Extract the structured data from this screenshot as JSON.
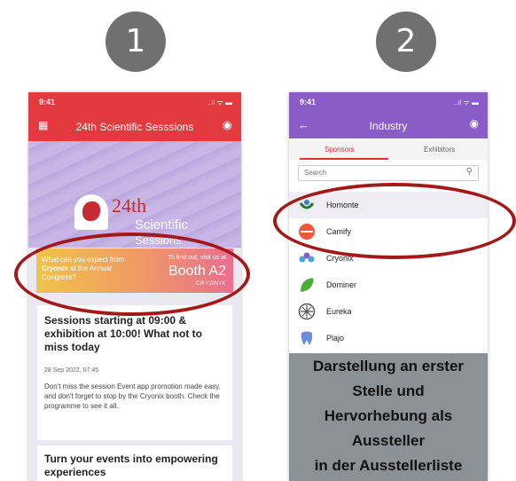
{
  "steps": [
    "1",
    "2"
  ],
  "phone1": {
    "status_time": "9:41",
    "status_icons": "..ıl ᯤ ▬",
    "title": "24th Scientific Sesssions",
    "grid_icon": "qr-grid-icon",
    "user_icon": "user-circle-icon",
    "banner": {
      "line1": "24th",
      "line2": "Scientific",
      "line3": "Sessions"
    },
    "ad": {
      "left_text_pre": "What can you expect from ",
      "left_text_brand": "Cryonix",
      "left_text_post": " at the Annual Congress?",
      "right_small": "To find out, visit us at",
      "right_big": "Booth A2",
      "brand": "CRYONIX"
    },
    "news": {
      "headline": "Sessions starting at 09:00 & exhibition at 10:00! What not to miss today",
      "date": "28 Sep 2022, 07:45",
      "body": "Don't miss the session Event app promotion made easy, and don't forget to stop by the Cryonix booth. Check the programme to see it all."
    },
    "news2": {
      "headline": "Turn your events into empowering experiences"
    }
  },
  "phone2": {
    "status_time": "9:41",
    "status_icons": "..ıl ᯤ ▬",
    "title": "Industry",
    "tabs": {
      "sponsors": "Sponsors",
      "exhibitors": "Exhibitors"
    },
    "search": {
      "placeholder": "Search",
      "value": ""
    },
    "sponsors": [
      {
        "name": "Homonte",
        "color": "#2f6f3f"
      },
      {
        "name": "Camify",
        "color": "#f0563a"
      },
      {
        "name": "Cryonix",
        "color": "#4fa3d8"
      },
      {
        "name": "Dominer",
        "color": "#4caf3c"
      },
      {
        "name": "Eureka",
        "color": "#555555"
      },
      {
        "name": "Plajo",
        "color": "#6a8fd8"
      }
    ],
    "caption": [
      "Darstellung an erster",
      "Stelle und",
      "Hervorhebung als",
      "Aussteller",
      "in der Ausstellerliste"
    ]
  },
  "colors": {
    "ring": "#a31818",
    "red_header": "#e23a3e",
    "purple_header": "#8a5cc7",
    "caption_bg": "#8c9196"
  }
}
